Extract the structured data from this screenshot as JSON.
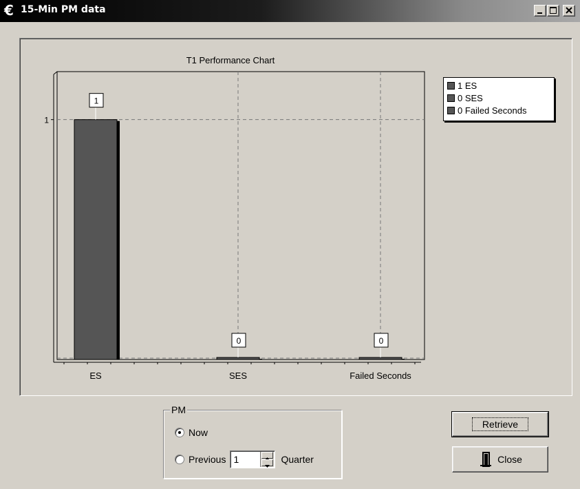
{
  "window": {
    "title": "15-Min PM data",
    "app_icon": "app-logo-icon"
  },
  "chart_data": {
    "type": "bar",
    "title": "T1 Performance Chart",
    "categories": [
      "ES",
      "SES",
      "Failed Seconds"
    ],
    "values": [
      1,
      0,
      0
    ],
    "data_labels": [
      "1",
      "0",
      "0"
    ],
    "ytick_labels": [
      "1"
    ],
    "ylim": [
      0,
      1.2
    ],
    "grid": true,
    "legend_position": "right",
    "legend": [
      "1 ES",
      "0 SES",
      "0 Failed Seconds"
    ],
    "bar_color": "#555555"
  },
  "pm": {
    "group_title": "PM",
    "now_label": "Now",
    "previous_label": "Previous",
    "quarter_value": "1",
    "quarter_label": "Quarter",
    "selected": "now"
  },
  "buttons": {
    "retrieve": "Retrieve",
    "close": "Close",
    "close_icon": "door-exit-icon"
  }
}
